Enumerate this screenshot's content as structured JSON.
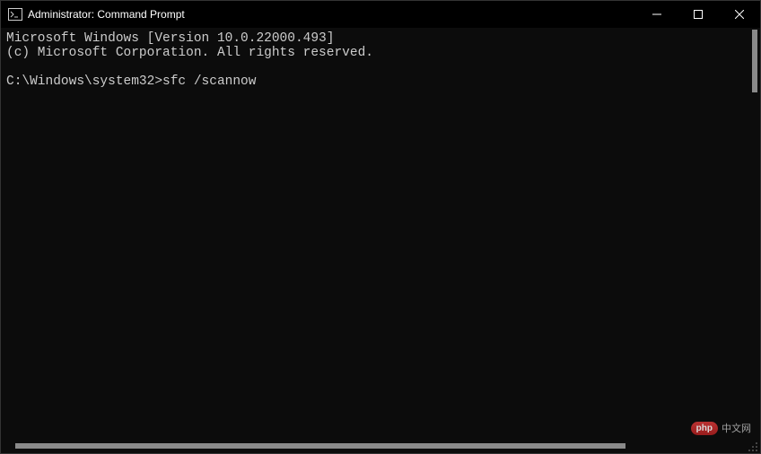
{
  "window": {
    "title": "Administrator: Command Prompt"
  },
  "terminal": {
    "line1": "Microsoft Windows [Version 10.0.22000.493]",
    "line2": "(c) Microsoft Corporation. All rights reserved.",
    "blank": "",
    "prompt": "C:\\Windows\\system32>",
    "command": "sfc /scannow"
  },
  "watermark": {
    "badge": "php",
    "text": "中文网"
  }
}
